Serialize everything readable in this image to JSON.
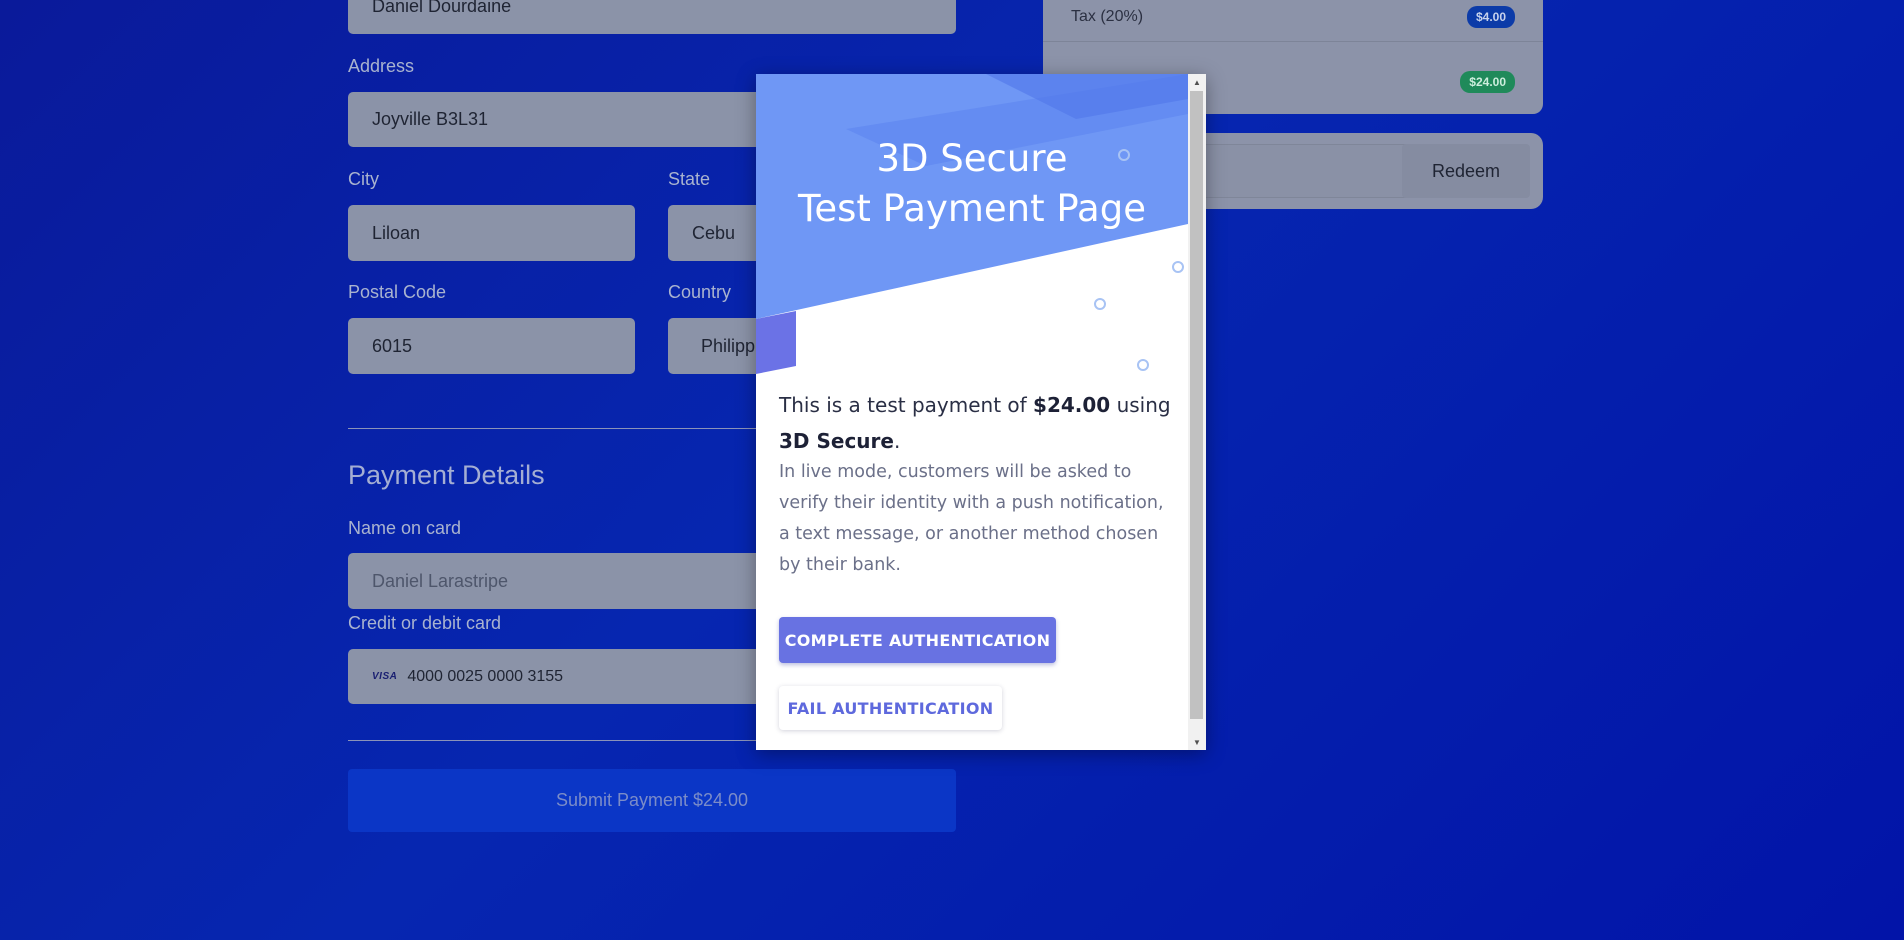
{
  "billing": {
    "name_value": "Daniel Dourdaine",
    "address_label": "Address",
    "address_value": "Joyville B3L31",
    "city_label": "City",
    "city_value": "Liloan",
    "state_label": "State",
    "state_value": "Cebu",
    "postal_label": "Postal Code",
    "postal_value": "6015",
    "country_label": "Country",
    "country_value": "Philipp"
  },
  "payment": {
    "section_title": "Payment Details",
    "name_on_card_label": "Name on card",
    "name_on_card_placeholder": "Daniel Larastripe",
    "card_label": "Credit or debit card",
    "card_brand": "VISA",
    "card_number": "4000 0025 0000 3155",
    "submit_label": "Submit Payment $24.00"
  },
  "summary": {
    "tax_label": "Tax (20%)",
    "tax_value": "$4.00",
    "total_value": "$24.00",
    "redeem_label": "Redeem"
  },
  "modal": {
    "title_line1": "3D Secure",
    "title_line2": "Test Payment Page",
    "lead_prefix": "This is a test payment of ",
    "lead_amount": "$24.00",
    "lead_mid": " using",
    "lead_method": "3D Secure",
    "lead_suffix": ".",
    "description": "In live mode, customers will be asked to verify their identity with a push notification, a text message, or another method chosen by their bank.",
    "complete_label": "COMPLETE AUTHENTICATION",
    "fail_label": "FAIL AUTHENTICATION"
  },
  "colors": {
    "background": "#0626b0",
    "modal_accent": "#6872e2",
    "header_blue": "#6f97f5"
  }
}
